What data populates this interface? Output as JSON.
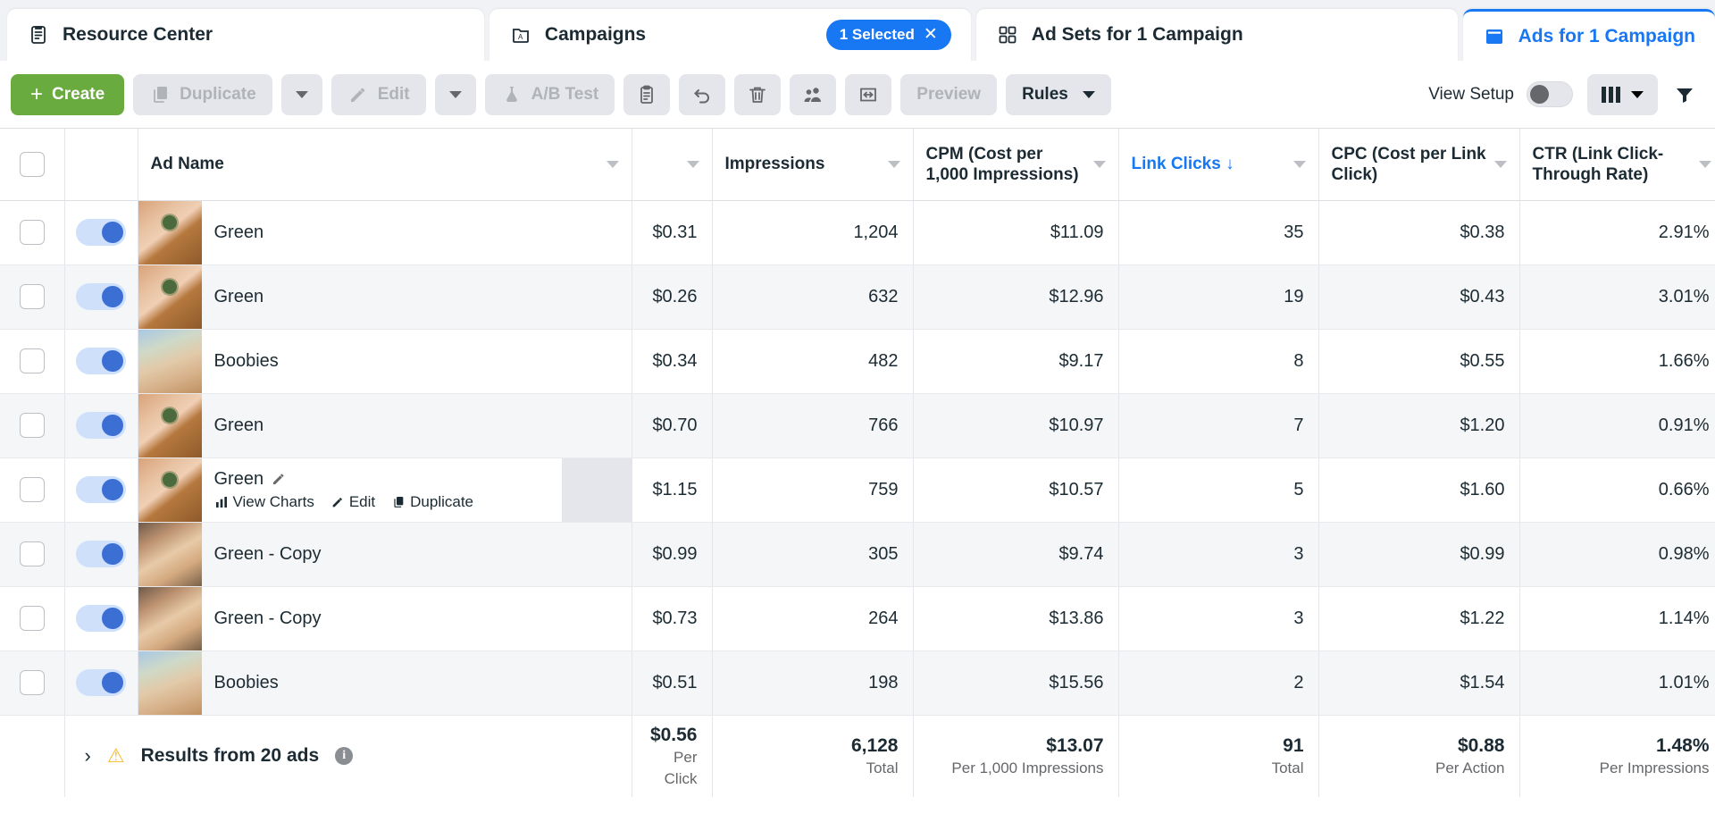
{
  "tabs": [
    {
      "label": "Resource Center",
      "icon": "clipboard-list-icon",
      "active": false,
      "badge": null
    },
    {
      "label": "Campaigns",
      "icon": "folder-a-icon",
      "active": false,
      "badge": "1 Selected"
    },
    {
      "label": "Ad Sets for 1 Campaign",
      "icon": "grid-squares-icon",
      "active": false,
      "badge": null
    },
    {
      "label": "Ads for 1 Campaign",
      "icon": "window-icon",
      "active": true,
      "badge": null
    }
  ],
  "toolbar": {
    "create_label": "Create",
    "create_plus": "+",
    "duplicate_label": "Duplicate",
    "edit_label": "Edit",
    "abtest_label": "A/B Test",
    "preview_label": "Preview",
    "rules_label": "Rules",
    "view_setup_label": "View Setup",
    "icon_buttons": [
      "clipboard-icon",
      "undo-icon",
      "trash-icon",
      "audience-icon",
      "export-icon"
    ],
    "colors": {
      "create_green": "#6aab3f",
      "accent_blue": "#1877f2",
      "grey_button": "#e4e6eb"
    }
  },
  "table": {
    "columns": [
      {
        "key": "check",
        "label": ""
      },
      {
        "key": "toggle",
        "label": ""
      },
      {
        "key": "name",
        "label": "Ad Name"
      },
      {
        "key": "cost",
        "label": ""
      },
      {
        "key": "impr",
        "label": "Impressions"
      },
      {
        "key": "cpm",
        "label": "CPM (Cost per 1,000 Impressions)"
      },
      {
        "key": "clicks",
        "label": "Link Clicks ↓",
        "sorted": true
      },
      {
        "key": "cpc",
        "label": "CPC (Cost per Link Click)"
      },
      {
        "key": "ctr",
        "label": "CTR (Link Click-Through Rate)"
      }
    ],
    "rows": [
      {
        "name": "Green",
        "thumb": "th-green",
        "enabled": true,
        "cost": "$0.31",
        "impressions": "1,204",
        "cpm": "$11.09",
        "link_clicks": "35",
        "cpc": "$0.38",
        "ctr": "2.91%",
        "hovered": false
      },
      {
        "name": "Green",
        "thumb": "th-green",
        "enabled": true,
        "cost": "$0.26",
        "impressions": "632",
        "cpm": "$12.96",
        "link_clicks": "19",
        "cpc": "$0.43",
        "ctr": "3.01%",
        "hovered": false
      },
      {
        "name": "Boobies",
        "thumb": "th-boobies",
        "enabled": true,
        "cost": "$0.34",
        "impressions": "482",
        "cpm": "$9.17",
        "link_clicks": "8",
        "cpc": "$0.55",
        "ctr": "1.66%",
        "hovered": false
      },
      {
        "name": "Green",
        "thumb": "th-green",
        "enabled": true,
        "cost": "$0.70",
        "impressions": "766",
        "cpm": "$10.97",
        "link_clicks": "7",
        "cpc": "$1.20",
        "ctr": "0.91%",
        "hovered": false
      },
      {
        "name": "Green",
        "thumb": "th-green",
        "enabled": true,
        "cost": "$1.15",
        "impressions": "759",
        "cpm": "$10.57",
        "link_clicks": "5",
        "cpc": "$1.60",
        "ctr": "0.66%",
        "hovered": true
      },
      {
        "name": "Green - Copy",
        "thumb": "th-copy",
        "enabled": true,
        "cost": "$0.99",
        "impressions": "305",
        "cpm": "$9.74",
        "link_clicks": "3",
        "cpc": "$0.99",
        "ctr": "0.98%",
        "hovered": false
      },
      {
        "name": "Green - Copy",
        "thumb": "th-copy",
        "enabled": true,
        "cost": "$0.73",
        "impressions": "264",
        "cpm": "$13.86",
        "link_clicks": "3",
        "cpc": "$1.22",
        "ctr": "1.14%",
        "hovered": false
      },
      {
        "name": "Boobies",
        "thumb": "th-boobies",
        "enabled": true,
        "cost": "$0.51",
        "impressions": "198",
        "cpm": "$15.56",
        "link_clicks": "2",
        "cpc": "$1.54",
        "ctr": "1.01%",
        "hovered": false
      }
    ],
    "hover_actions": {
      "view_charts": "View Charts",
      "edit": "Edit",
      "duplicate": "Duplicate"
    },
    "summary": {
      "label": "Results from 20 ads",
      "cost": {
        "value": "$0.56",
        "sub": "Per Click"
      },
      "impressions": {
        "value": "6,128",
        "sub": "Total"
      },
      "cpm": {
        "value": "$13.07",
        "sub": "Per 1,000 Impressions"
      },
      "link_clicks": {
        "value": "91",
        "sub": "Total"
      },
      "cpc": {
        "value": "$0.88",
        "sub": "Per Action"
      },
      "ctr": {
        "value": "1.48%",
        "sub": "Per Impressions"
      }
    }
  }
}
